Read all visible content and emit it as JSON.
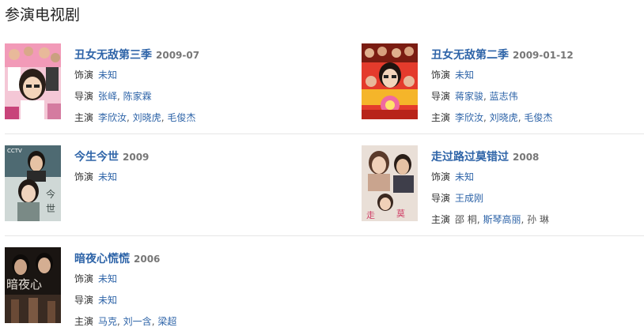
{
  "section": {
    "title": "参演电视剧"
  },
  "shows": [
    {
      "title": "丑女无敌第三季",
      "year": "2009-07",
      "role_label": "饰演",
      "role": "未知",
      "director_label": "导演",
      "directors": [
        "张峄",
        "陈家霖"
      ],
      "cast_label": "主演",
      "cast": [
        "李欣汝",
        "刘晓虎",
        "毛俊杰"
      ]
    },
    {
      "title": "丑女无敌第二季",
      "year": "2009-01-12",
      "role_label": "饰演",
      "role": "未知",
      "director_label": "导演",
      "directors": [
        "蒋家骏",
        "蓝志伟"
      ],
      "cast_label": "主演",
      "cast": [
        "李欣汝",
        "刘晓虎",
        "毛俊杰"
      ]
    },
    {
      "title": "今生今世",
      "year": "2009",
      "role_label": "饰演",
      "role": "未知"
    },
    {
      "title": "走过路过莫错过",
      "year": "2008",
      "role_label": "饰演",
      "role": "未知",
      "director_label": "导演",
      "directors": [
        "王成刚"
      ],
      "cast_label": "主演",
      "cast": [
        "邵 桐",
        "斯琴高丽",
        "孙 琳"
      ]
    },
    {
      "title": "暗夜心慌慌",
      "year": "2006",
      "role_label": "饰演",
      "role": "未知",
      "director_label": "导演",
      "directors": [
        "未知"
      ],
      "cast_label": "主演",
      "cast": [
        "马克",
        "刘一含",
        "梁超"
      ]
    }
  ],
  "colors": {
    "link": "#2e64a8",
    "year": "#777777",
    "divider": "#e6e6e6"
  },
  "poster_overlay_text": {
    "p3": "CCTV"
  }
}
